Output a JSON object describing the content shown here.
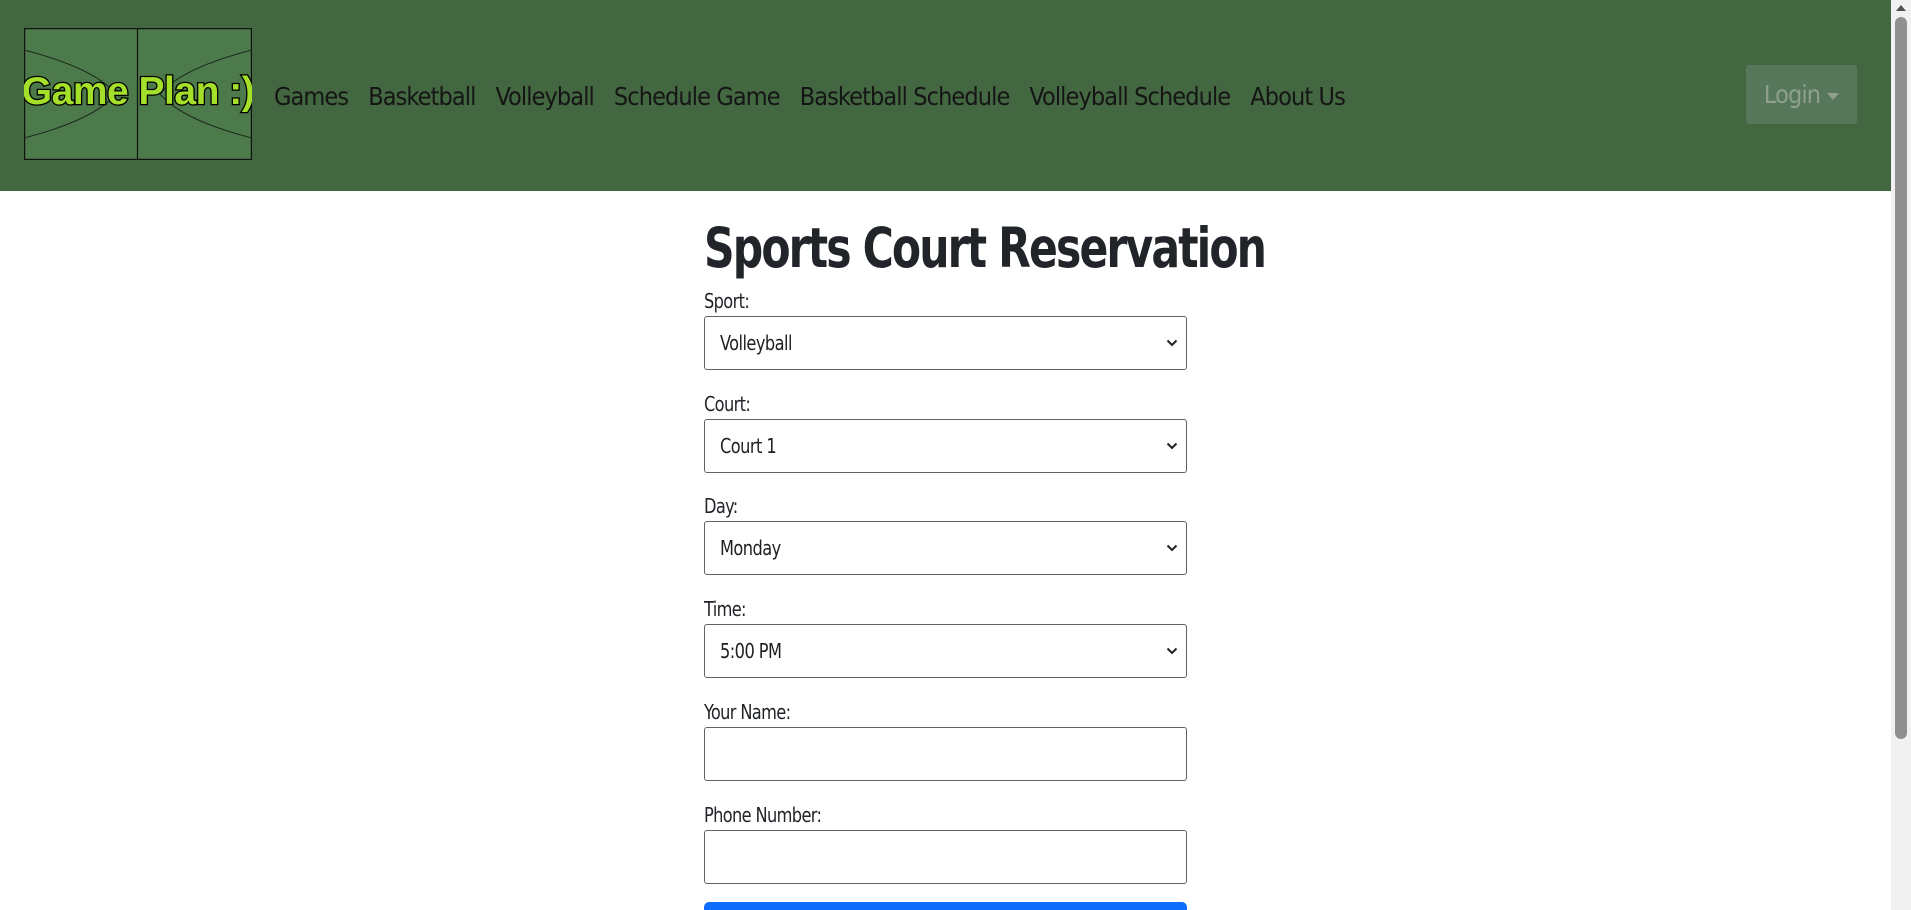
{
  "header": {
    "logo_text": "Game Plan :)",
    "nav": [
      {
        "label": "Games"
      },
      {
        "label": "Basketball"
      },
      {
        "label": "Volleyball"
      },
      {
        "label": "Schedule Game"
      },
      {
        "label": "Basketball Schedule"
      },
      {
        "label": "Volleyball Schedule"
      },
      {
        "label": "About Us"
      }
    ],
    "login_label": "Login"
  },
  "form": {
    "title": "Sports Court Reservation",
    "sport": {
      "label": "Sport:",
      "value": "Volleyball"
    },
    "court": {
      "label": "Court:",
      "value": "Court 1"
    },
    "day": {
      "label": "Day:",
      "value": "Monday"
    },
    "time": {
      "label": "Time:",
      "value": "5:00 PM"
    },
    "name": {
      "label": "Your Name:",
      "value": ""
    },
    "phone": {
      "label": "Phone Number:",
      "value": ""
    }
  },
  "colors": {
    "navbar_bg": "#436740",
    "login_bg": "#56775a",
    "logo_text": "#a4e02a",
    "submit_bg": "#0d6efd"
  },
  "icons": {
    "select_chevron": "chevron-down-icon",
    "login_caret": "caret-down-icon"
  }
}
